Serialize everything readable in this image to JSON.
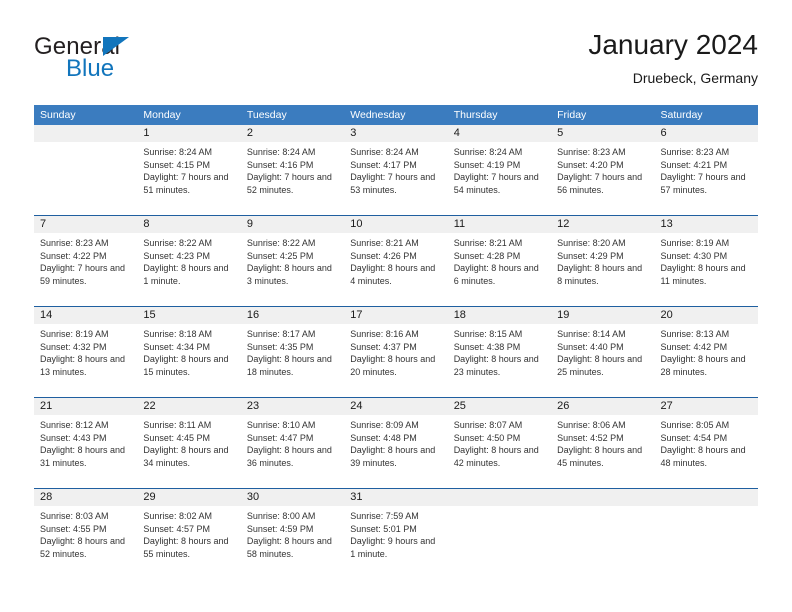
{
  "logo": {
    "word1": "General",
    "word2": "Blue",
    "triangle_color": "#1275bc",
    "text_color": "#231f20"
  },
  "header": {
    "title": "January 2024",
    "subtitle": "Druebeck, Germany"
  },
  "theme": {
    "header_blue": "#3b7cbf",
    "separator_blue": "#1f5fa0",
    "daynum_band": "#f0f0f0",
    "body_text": "#333333"
  },
  "calendar": {
    "weekdays": [
      "Sunday",
      "Monday",
      "Tuesday",
      "Wednesday",
      "Thursday",
      "Friday",
      "Saturday"
    ],
    "weeks": [
      [
        {
          "day": ""
        },
        {
          "day": "1",
          "sunrise": "Sunrise: 8:24 AM",
          "sunset": "Sunset: 4:15 PM",
          "daylight": "Daylight: 7 hours and 51 minutes."
        },
        {
          "day": "2",
          "sunrise": "Sunrise: 8:24 AM",
          "sunset": "Sunset: 4:16 PM",
          "daylight": "Daylight: 7 hours and 52 minutes."
        },
        {
          "day": "3",
          "sunrise": "Sunrise: 8:24 AM",
          "sunset": "Sunset: 4:17 PM",
          "daylight": "Daylight: 7 hours and 53 minutes."
        },
        {
          "day": "4",
          "sunrise": "Sunrise: 8:24 AM",
          "sunset": "Sunset: 4:19 PM",
          "daylight": "Daylight: 7 hours and 54 minutes."
        },
        {
          "day": "5",
          "sunrise": "Sunrise: 8:23 AM",
          "sunset": "Sunset: 4:20 PM",
          "daylight": "Daylight: 7 hours and 56 minutes."
        },
        {
          "day": "6",
          "sunrise": "Sunrise: 8:23 AM",
          "sunset": "Sunset: 4:21 PM",
          "daylight": "Daylight: 7 hours and 57 minutes."
        }
      ],
      [
        {
          "day": "7",
          "sunrise": "Sunrise: 8:23 AM",
          "sunset": "Sunset: 4:22 PM",
          "daylight": "Daylight: 7 hours and 59 minutes."
        },
        {
          "day": "8",
          "sunrise": "Sunrise: 8:22 AM",
          "sunset": "Sunset: 4:23 PM",
          "daylight": "Daylight: 8 hours and 1 minute."
        },
        {
          "day": "9",
          "sunrise": "Sunrise: 8:22 AM",
          "sunset": "Sunset: 4:25 PM",
          "daylight": "Daylight: 8 hours and 3 minutes."
        },
        {
          "day": "10",
          "sunrise": "Sunrise: 8:21 AM",
          "sunset": "Sunset: 4:26 PM",
          "daylight": "Daylight: 8 hours and 4 minutes."
        },
        {
          "day": "11",
          "sunrise": "Sunrise: 8:21 AM",
          "sunset": "Sunset: 4:28 PM",
          "daylight": "Daylight: 8 hours and 6 minutes."
        },
        {
          "day": "12",
          "sunrise": "Sunrise: 8:20 AM",
          "sunset": "Sunset: 4:29 PM",
          "daylight": "Daylight: 8 hours and 8 minutes."
        },
        {
          "day": "13",
          "sunrise": "Sunrise: 8:19 AM",
          "sunset": "Sunset: 4:30 PM",
          "daylight": "Daylight: 8 hours and 11 minutes."
        }
      ],
      [
        {
          "day": "14",
          "sunrise": "Sunrise: 8:19 AM",
          "sunset": "Sunset: 4:32 PM",
          "daylight": "Daylight: 8 hours and 13 minutes."
        },
        {
          "day": "15",
          "sunrise": "Sunrise: 8:18 AM",
          "sunset": "Sunset: 4:34 PM",
          "daylight": "Daylight: 8 hours and 15 minutes."
        },
        {
          "day": "16",
          "sunrise": "Sunrise: 8:17 AM",
          "sunset": "Sunset: 4:35 PM",
          "daylight": "Daylight: 8 hours and 18 minutes."
        },
        {
          "day": "17",
          "sunrise": "Sunrise: 8:16 AM",
          "sunset": "Sunset: 4:37 PM",
          "daylight": "Daylight: 8 hours and 20 minutes."
        },
        {
          "day": "18",
          "sunrise": "Sunrise: 8:15 AM",
          "sunset": "Sunset: 4:38 PM",
          "daylight": "Daylight: 8 hours and 23 minutes."
        },
        {
          "day": "19",
          "sunrise": "Sunrise: 8:14 AM",
          "sunset": "Sunset: 4:40 PM",
          "daylight": "Daylight: 8 hours and 25 minutes."
        },
        {
          "day": "20",
          "sunrise": "Sunrise: 8:13 AM",
          "sunset": "Sunset: 4:42 PM",
          "daylight": "Daylight: 8 hours and 28 minutes."
        }
      ],
      [
        {
          "day": "21",
          "sunrise": "Sunrise: 8:12 AM",
          "sunset": "Sunset: 4:43 PM",
          "daylight": "Daylight: 8 hours and 31 minutes."
        },
        {
          "day": "22",
          "sunrise": "Sunrise: 8:11 AM",
          "sunset": "Sunset: 4:45 PM",
          "daylight": "Daylight: 8 hours and 34 minutes."
        },
        {
          "day": "23",
          "sunrise": "Sunrise: 8:10 AM",
          "sunset": "Sunset: 4:47 PM",
          "daylight": "Daylight: 8 hours and 36 minutes."
        },
        {
          "day": "24",
          "sunrise": "Sunrise: 8:09 AM",
          "sunset": "Sunset: 4:48 PM",
          "daylight": "Daylight: 8 hours and 39 minutes."
        },
        {
          "day": "25",
          "sunrise": "Sunrise: 8:07 AM",
          "sunset": "Sunset: 4:50 PM",
          "daylight": "Daylight: 8 hours and 42 minutes."
        },
        {
          "day": "26",
          "sunrise": "Sunrise: 8:06 AM",
          "sunset": "Sunset: 4:52 PM",
          "daylight": "Daylight: 8 hours and 45 minutes."
        },
        {
          "day": "27",
          "sunrise": "Sunrise: 8:05 AM",
          "sunset": "Sunset: 4:54 PM",
          "daylight": "Daylight: 8 hours and 48 minutes."
        }
      ],
      [
        {
          "day": "28",
          "sunrise": "Sunrise: 8:03 AM",
          "sunset": "Sunset: 4:55 PM",
          "daylight": "Daylight: 8 hours and 52 minutes."
        },
        {
          "day": "29",
          "sunrise": "Sunrise: 8:02 AM",
          "sunset": "Sunset: 4:57 PM",
          "daylight": "Daylight: 8 hours and 55 minutes."
        },
        {
          "day": "30",
          "sunrise": "Sunrise: 8:00 AM",
          "sunset": "Sunset: 4:59 PM",
          "daylight": "Daylight: 8 hours and 58 minutes."
        },
        {
          "day": "31",
          "sunrise": "Sunrise: 7:59 AM",
          "sunset": "Sunset: 5:01 PM",
          "daylight": "Daylight: 9 hours and 1 minute."
        },
        {
          "day": ""
        },
        {
          "day": ""
        },
        {
          "day": ""
        }
      ]
    ]
  }
}
